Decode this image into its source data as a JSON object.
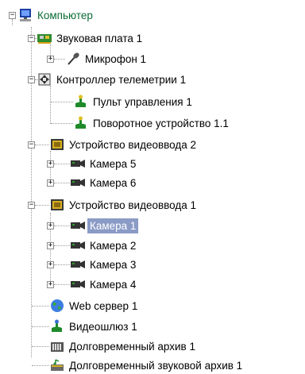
{
  "tree": {
    "computer": {
      "label": "Компьютер",
      "icon": "computer-icon"
    },
    "sound_card": {
      "label": "Звуковая плата 1",
      "icon": "sound-card-icon"
    },
    "microphone": {
      "label": "Микрофон 1",
      "icon": "microphone-icon"
    },
    "telemetry": {
      "label": "Контроллер телеметрии 1",
      "icon": "telemetry-controller-icon"
    },
    "control_panel": {
      "label": "Пульт управления 1",
      "icon": "control-panel-icon"
    },
    "ptz": {
      "label": "Поворотное устройство 1.1",
      "icon": "ptz-device-icon"
    },
    "video_input_2": {
      "label": "Устройство видеоввода 2",
      "icon": "video-input-icon"
    },
    "camera_5": {
      "label": "Камера 5",
      "icon": "camera-icon"
    },
    "camera_6": {
      "label": "Камера 6",
      "icon": "camera-icon"
    },
    "video_input_1": {
      "label": "Устройство видеоввода 1",
      "icon": "video-input-icon"
    },
    "camera_1": {
      "label": "Камера 1",
      "icon": "camera-icon",
      "selected": true
    },
    "camera_2": {
      "label": "Камера 2",
      "icon": "camera-icon"
    },
    "camera_3": {
      "label": "Камера 3",
      "icon": "camera-icon"
    },
    "camera_4": {
      "label": "Камера 4",
      "icon": "camera-icon"
    },
    "web_server": {
      "label": "Web сервер 1",
      "icon": "globe-icon"
    },
    "video_gateway": {
      "label": "Видеошлюз 1",
      "icon": "gateway-icon"
    },
    "archive": {
      "label": "Долговременный архив 1",
      "icon": "archive-icon"
    },
    "audio_archive": {
      "label": "Долговременный звуковой архив 1",
      "icon": "audio-archive-icon"
    }
  },
  "colors": {
    "selection": "#8a9bc6",
    "root_label": "#0a6b34",
    "tree_lines": "#9a9a9a"
  }
}
